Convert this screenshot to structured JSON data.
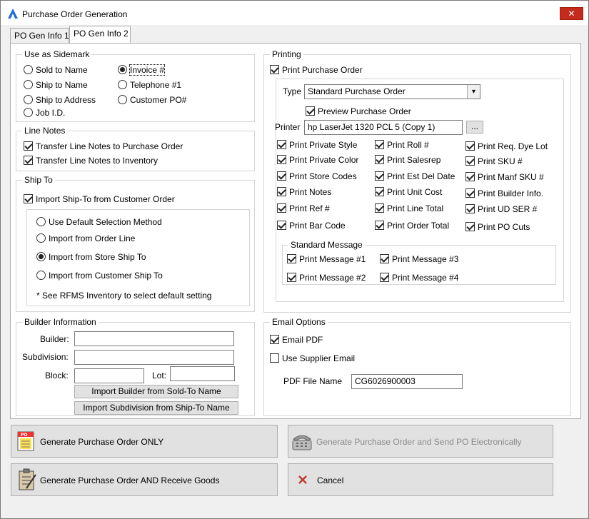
{
  "window": {
    "title": "Purchase Order Generation",
    "close_label": "✕"
  },
  "tabs": [
    {
      "label": "PO Gen Info 1"
    },
    {
      "label": "PO Gen Info 2"
    }
  ],
  "sidemark": {
    "title": "Use as Sidemark",
    "options": [
      {
        "label": "Sold to Name",
        "checked": false
      },
      {
        "label": "Ship to Name",
        "checked": false
      },
      {
        "label": "Ship to Address",
        "checked": false
      },
      {
        "label": "Job I.D.",
        "checked": false
      },
      {
        "label": "Invoice #",
        "checked": true
      },
      {
        "label": "Telephone #1",
        "checked": false
      },
      {
        "label": "Customer PO#",
        "checked": false
      }
    ]
  },
  "line_notes": {
    "title": "Line Notes",
    "options": [
      {
        "label": "Transfer Line Notes to Purchase Order",
        "checked": true
      },
      {
        "label": "Transfer Line Notes to Inventory",
        "checked": true
      }
    ]
  },
  "ship_to": {
    "title": "Ship To",
    "import_label": "Import Ship-To from Customer Order",
    "import_checked": true,
    "options": [
      {
        "label": "Use Default Selection Method",
        "checked": false
      },
      {
        "label": "Import from Order Line",
        "checked": false
      },
      {
        "label": "Import from Store Ship To",
        "checked": true
      },
      {
        "label": "Import from Customer Ship To",
        "checked": false
      }
    ],
    "note": "* See RFMS Inventory to select default setting"
  },
  "builder": {
    "title": "Builder Information",
    "builder_label": "Builder:",
    "subdivision_label": "Subdivision:",
    "block_label": "Block:",
    "lot_label": "Lot:",
    "builder_value": "",
    "subdivision_value": "",
    "block_value": "",
    "lot_value": "",
    "import_builder_btn": "Import Builder from Sold-To Name",
    "import_subdivision_btn": "Import Subdivision from Ship-To Name"
  },
  "printing": {
    "title": "Printing",
    "print_po_label": "Print Purchase Order",
    "print_po_checked": true,
    "type_label": "Type",
    "type_value": "Standard Purchase Order",
    "preview_label": "Preview Purchase Order",
    "preview_checked": true,
    "printer_label": "Printer",
    "printer_value": "hp LaserJet 1320 PCL 5 (Copy 1)",
    "printer_browse": "...",
    "col1": [
      {
        "label": "Print Private Style",
        "checked": true
      },
      {
        "label": "Print Private Color",
        "checked": true
      },
      {
        "label": "Print Store Codes",
        "checked": true
      },
      {
        "label": "Print Notes",
        "checked": true
      },
      {
        "label": "Print Ref #",
        "checked": true
      },
      {
        "label": "Print Bar Code",
        "checked": true
      }
    ],
    "col2": [
      {
        "label": "Print Roll #",
        "checked": true
      },
      {
        "label": "Print Salesrep",
        "checked": true
      },
      {
        "label": "Print Est Del Date",
        "checked": true
      },
      {
        "label": "Print Unit Cost",
        "checked": true
      },
      {
        "label": "Print Line Total",
        "checked": true
      },
      {
        "label": "Print Order Total",
        "checked": true
      }
    ],
    "col3": [
      {
        "label": "Print Req. Dye Lot",
        "checked": true
      },
      {
        "label": "Print SKU #",
        "checked": true
      },
      {
        "label": "Print Manf SKU #",
        "checked": true
      },
      {
        "label": "Print Builder Info.",
        "checked": true
      },
      {
        "label": "Print UD SER #",
        "checked": true
      },
      {
        "label": "Print PO Cuts",
        "checked": true
      }
    ],
    "std_message": {
      "title": "Standard Message",
      "options": [
        {
          "label": "Print Message #1",
          "checked": true
        },
        {
          "label": "Print Message #3",
          "checked": true
        },
        {
          "label": "Print Message #2",
          "checked": true
        },
        {
          "label": "Print Message #4",
          "checked": true
        }
      ]
    }
  },
  "email": {
    "title": "Email Options",
    "email_pdf_label": "Email PDF",
    "email_pdf_checked": true,
    "use_supplier_label": "Use Supplier Email",
    "use_supplier_checked": false,
    "pdf_name_label": "PDF File Name",
    "pdf_name_value": "CG6026900003"
  },
  "actions": {
    "generate_only": "Generate Purchase Order ONLY",
    "generate_send": "Generate Purchase Order and Send PO Electronically",
    "generate_receive": "Generate Purchase Order AND Receive Goods",
    "cancel": "Cancel"
  },
  "colors": {
    "accent": "#1e6fd9",
    "cancel_x": "#c0392b",
    "close_bg": "#c42b1c"
  }
}
